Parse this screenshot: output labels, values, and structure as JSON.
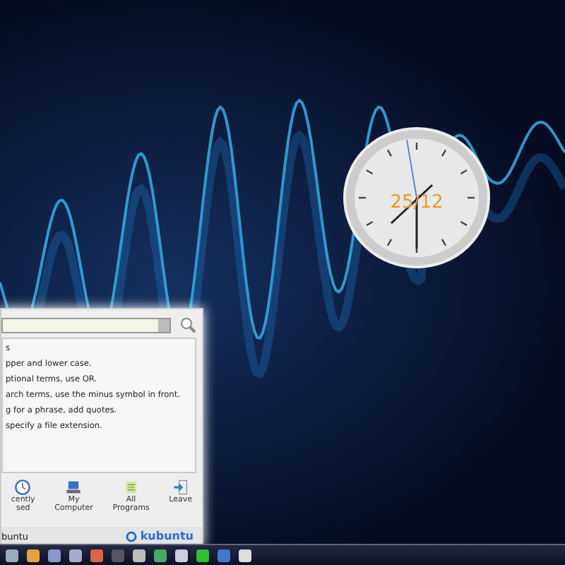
{
  "clock": {
    "date": "25/12"
  },
  "launcher": {
    "help_lines": [
      "s",
      "pper and lower case.",
      "ptional terms, use OR.",
      "arch terms, use the minus symbol in front.",
      "g for a phrase, add quotes.",
      "specify a file extension."
    ],
    "tabs": [
      {
        "label": "cently\nsed",
        "kind": "clock",
        "selected": false
      },
      {
        "label": "My\nComputer",
        "kind": "computer",
        "selected": false
      },
      {
        "label": "All\nPrograms",
        "kind": "list",
        "selected": false
      },
      {
        "label": "Leave",
        "kind": "leave",
        "selected": false
      }
    ],
    "footer_user": "buntu",
    "footer_logo": "kubuntu"
  }
}
